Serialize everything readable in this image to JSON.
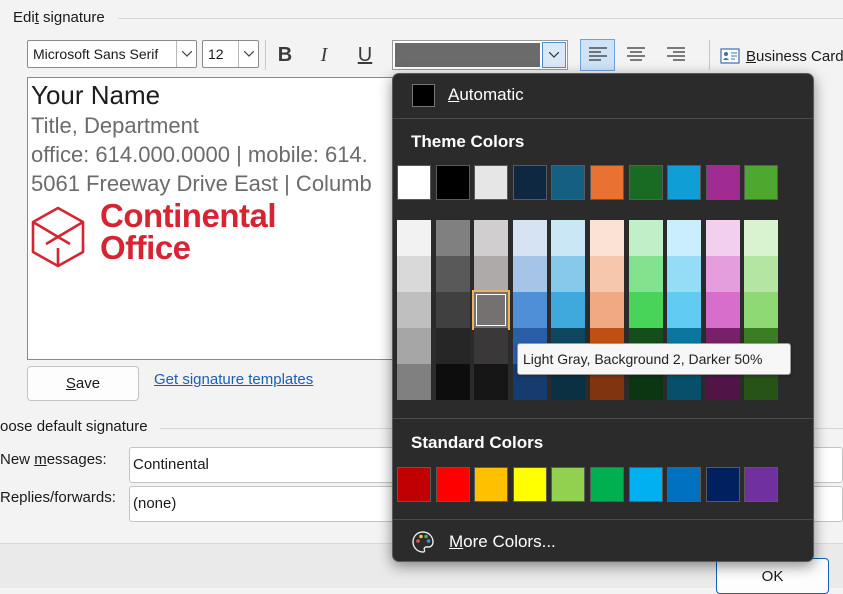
{
  "dialog": {
    "section_title_pre": "Edi",
    "section_title_ul": "t",
    "section_title_post": " signature"
  },
  "toolbar": {
    "font_name": "Microsoft Sans Serif",
    "font_size": "12",
    "bold_label": "B",
    "italic_label": "I",
    "underline_label": "U",
    "font_color": "#6b6b6b",
    "business_card_ul": "B",
    "business_card_rest": "usiness Card"
  },
  "signature": {
    "name": "Your Name",
    "title": "Title, Department",
    "phones": "office: 614.000.0000 | mobile: 614.",
    "address": "5061 Freeway Drive East | Columb",
    "logo_line1": "Continental",
    "logo_line2": "Office",
    "logo_color": "#d62433"
  },
  "buttons": {
    "save_ul": "S",
    "save_rest": "ave",
    "templates_link": "Get signature templates",
    "ok": "OK"
  },
  "defaults": {
    "section_title": "oose default signature",
    "new_messages_pre": "New ",
    "new_messages_ul": "m",
    "new_messages_post": "essages:",
    "new_messages_value": "Continental",
    "replies_label": "Replies/forwards:",
    "replies_value": "(none)"
  },
  "color_popup": {
    "automatic_ul": "A",
    "automatic_rest": "utomatic",
    "theme_heading": "Theme Colors",
    "theme_row": [
      "#ffffff",
      "#000000",
      "#e7e6e6",
      "#0e2841",
      "#156082",
      "#e97132",
      "#196b24",
      "#0f9ed5",
      "#a02b93",
      "#4ea72e"
    ],
    "theme_shades": [
      [
        "#f2f2f2",
        "#d9d9d9",
        "#bfbfbf",
        "#a6a6a6",
        "#808080"
      ],
      [
        "#808080",
        "#595959",
        "#404040",
        "#262626",
        "#0d0d0d"
      ],
      [
        "#d0cece",
        "#aeaaaa",
        "#757171",
        "#3a3838",
        "#171616"
      ],
      [
        "#d6e3f3",
        "#a5c4e8",
        "#4f8fd8",
        "#2a5ea6",
        "#163c6e"
      ],
      [
        "#c9e7f5",
        "#86c9ea",
        "#3fa8dc",
        "#0f4761",
        "#0a3041"
      ],
      [
        "#fbe2d5",
        "#f6c6ad",
        "#f1a983",
        "#c04f15",
        "#803510"
      ],
      [
        "#c1f0c8",
        "#83e28e",
        "#47d459",
        "#124f1a",
        "#0c3511"
      ],
      [
        "#caeefb",
        "#95dcf7",
        "#61cbf3",
        "#0b76a0",
        "#074f6a"
      ],
      [
        "#f2cfee",
        "#e49edd",
        "#d86ecc",
        "#782069",
        "#501546"
      ],
      [
        "#d9f2d0",
        "#b4e5a2",
        "#8ed973",
        "#3b7d23",
        "#275317"
      ]
    ],
    "tooltip": "Light Gray, Background 2, Darker 50%",
    "standard_heading": "Standard Colors",
    "standard_row": [
      "#c00000",
      "#ff0000",
      "#ffc000",
      "#ffff00",
      "#92d050",
      "#00b050",
      "#00b0f0",
      "#0070c0",
      "#002060",
      "#7030a0"
    ],
    "more_ul": "M",
    "more_rest": "ore Colors..."
  }
}
